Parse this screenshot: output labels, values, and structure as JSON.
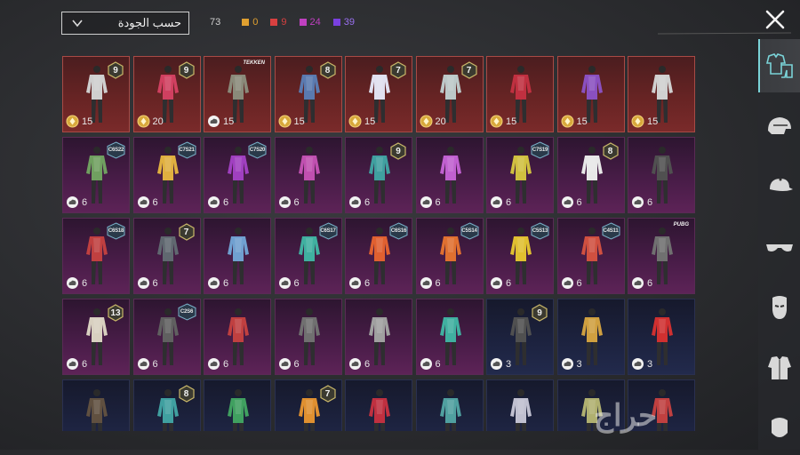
{
  "toolbar": {
    "sort_label": "حسب الجودة",
    "total": "73",
    "quality_counts": [
      {
        "value": "0",
        "color": "#e0a030"
      },
      {
        "value": "9",
        "color": "#d84040"
      },
      {
        "value": "24",
        "color": "#c040c0"
      },
      {
        "value": "39",
        "color": "#7a40e0"
      }
    ]
  },
  "sidebar": {
    "tabs": [
      {
        "icon": "outfit-icon",
        "active": true
      },
      {
        "icon": "helmet-icon",
        "active": false
      },
      {
        "icon": "cap-icon",
        "active": false
      },
      {
        "icon": "sunglasses-icon",
        "active": false
      },
      {
        "icon": "mask-icon",
        "active": false
      },
      {
        "icon": "jacket-icon",
        "active": false
      },
      {
        "icon": "face-icon",
        "active": false
      }
    ]
  },
  "watermark": "حراج",
  "items": [
    {
      "tier": "red",
      "badge": "9",
      "price": "15",
      "cur": "gold",
      "color": "#cfcfcf"
    },
    {
      "tier": "red",
      "badge": "9",
      "price": "20",
      "cur": "gold",
      "color": "#d04060"
    },
    {
      "tier": "red",
      "logo": "TEKKEN",
      "price": "15",
      "cur": "cloud",
      "color": "#8a8a7a"
    },
    {
      "tier": "red",
      "badge": "8",
      "price": "15",
      "cur": "gold",
      "color": "#5a7ab0"
    },
    {
      "tier": "red",
      "badge": "7",
      "price": "15",
      "cur": "gold",
      "color": "#e0e0f0"
    },
    {
      "tier": "red",
      "badge": "7",
      "price": "20",
      "cur": "gold",
      "color": "#bcc8c8"
    },
    {
      "tier": "red",
      "price": "15",
      "cur": "gold",
      "color": "#c03040"
    },
    {
      "tier": "red",
      "price": "15",
      "cur": "gold",
      "color": "#8a50c0"
    },
    {
      "tier": "red",
      "price": "15",
      "cur": "gold",
      "color": "#d0d0d0"
    },
    {
      "tier": "purple",
      "code": "C6S22",
      "price": "6",
      "cur": "cloud",
      "color": "#70a060"
    },
    {
      "tier": "purple",
      "code": "C7S21",
      "price": "6",
      "cur": "cloud",
      "color": "#e0b040"
    },
    {
      "tier": "purple",
      "code": "C7S20",
      "price": "6",
      "cur": "cloud",
      "color": "#a040c0"
    },
    {
      "tier": "purple",
      "price": "6",
      "cur": "cloud",
      "color": "#c050b0"
    },
    {
      "tier": "purple",
      "badge": "9",
      "price": "6",
      "cur": "cloud",
      "color": "#40a0a0"
    },
    {
      "tier": "purple",
      "price": "6",
      "cur": "cloud",
      "color": "#c060d0"
    },
    {
      "tier": "purple",
      "code": "C7S19",
      "price": "6",
      "cur": "cloud",
      "color": "#d0c040"
    },
    {
      "tier": "purple",
      "badge": "8",
      "price": "6",
      "cur": "cloud",
      "color": "#e8e8e8"
    },
    {
      "tier": "purple",
      "price": "6",
      "cur": "cloud",
      "color": "#505050"
    },
    {
      "tier": "purple",
      "code": "C6S18",
      "price": "6",
      "cur": "cloud",
      "color": "#c04040"
    },
    {
      "tier": "purple",
      "badge": "7",
      "price": "6",
      "cur": "cloud",
      "color": "#606870"
    },
    {
      "tier": "purple",
      "price": "6",
      "cur": "cloud",
      "color": "#70a0d0"
    },
    {
      "tier": "purple",
      "code": "C6S17",
      "price": "6",
      "cur": "cloud",
      "color": "#40b0a0"
    },
    {
      "tier": "purple",
      "code": "C6S16",
      "price": "6",
      "cur": "cloud",
      "color": "#e06030"
    },
    {
      "tier": "purple",
      "code": "C5S14",
      "price": "6",
      "cur": "cloud",
      "color": "#e07030"
    },
    {
      "tier": "purple",
      "code": "C5S13",
      "price": "6",
      "cur": "cloud",
      "color": "#e0c030"
    },
    {
      "tier": "purple",
      "code": "C4S11",
      "price": "6",
      "cur": "cloud",
      "color": "#d05040"
    },
    {
      "tier": "purple",
      "logo": "PUBG",
      "price": "6",
      "cur": "cloud",
      "color": "#707070"
    },
    {
      "tier": "purple",
      "badge": "13",
      "price": "6",
      "cur": "cloud",
      "color": "#d8d0c0"
    },
    {
      "tier": "purple",
      "code": "C2S6",
      "price": "6",
      "cur": "cloud",
      "color": "#606060"
    },
    {
      "tier": "purple",
      "price": "6",
      "cur": "cloud",
      "color": "#c04040"
    },
    {
      "tier": "purple",
      "price": "6",
      "cur": "cloud",
      "color": "#707070"
    },
    {
      "tier": "purple",
      "price": "6",
      "cur": "cloud",
      "color": "#a0a0a0"
    },
    {
      "tier": "purple",
      "price": "6",
      "cur": "cloud",
      "color": "#40b0a0"
    },
    {
      "tier": "blue",
      "badge": "9",
      "price": "3",
      "cur": "cloud",
      "color": "#505050"
    },
    {
      "tier": "blue",
      "price": "3",
      "cur": "cloud",
      "color": "#d0a040"
    },
    {
      "tier": "blue",
      "price": "3",
      "cur": "cloud",
      "color": "#d03030"
    },
    {
      "tier": "blue",
      "price": "",
      "cur": "",
      "color": "#605040"
    },
    {
      "tier": "blue",
      "badge": "8",
      "price": "",
      "cur": "",
      "color": "#40a0a0"
    },
    {
      "tier": "blue",
      "price": "",
      "cur": "",
      "color": "#40a060"
    },
    {
      "tier": "blue",
      "badge": "7",
      "price": "",
      "cur": "",
      "color": "#e09030"
    },
    {
      "tier": "blue",
      "price": "",
      "cur": "",
      "color": "#c03040"
    },
    {
      "tier": "blue",
      "price": "",
      "cur": "",
      "color": "#50a0a0"
    },
    {
      "tier": "blue",
      "price": "",
      "cur": "",
      "color": "#c0c0d0"
    },
    {
      "tier": "blue",
      "price": "",
      "cur": "",
      "color": "#b0b070"
    },
    {
      "tier": "blue",
      "price": "",
      "cur": "",
      "color": "#c04040"
    }
  ]
}
